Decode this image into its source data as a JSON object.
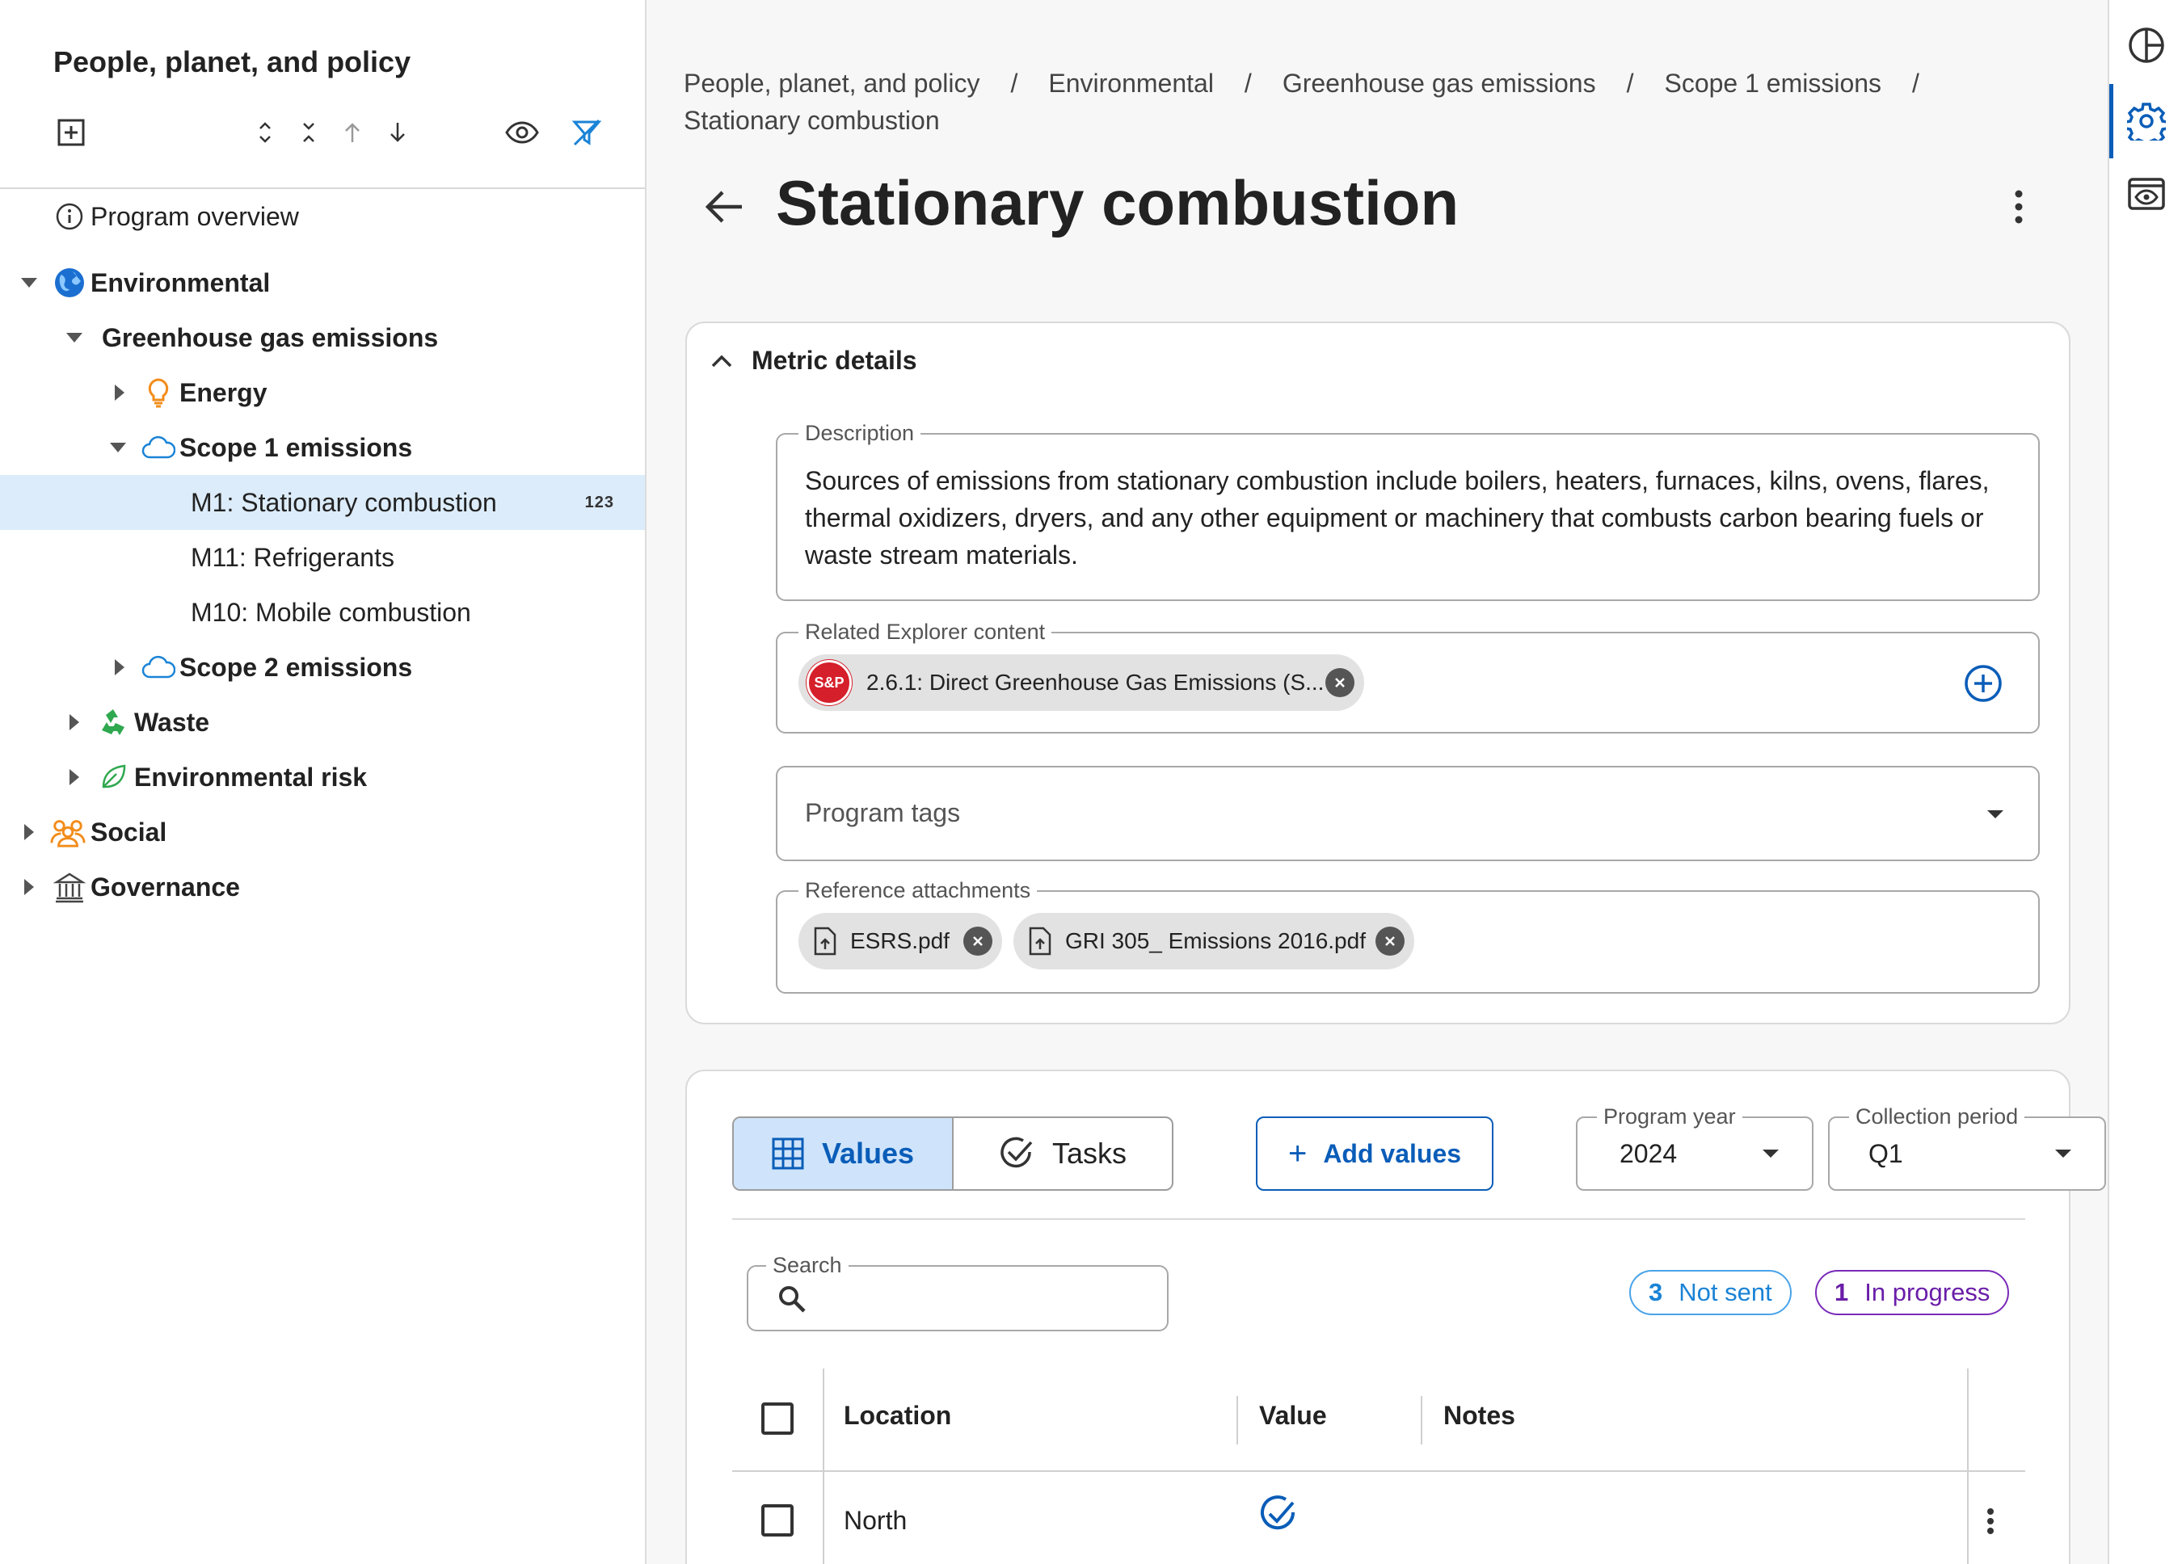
{
  "sidebar": {
    "title": "People, planet, and policy",
    "tree": [
      {
        "label": "Program overview",
        "icon": "info-icon",
        "bold": false
      },
      {
        "label": "Environmental",
        "icon": "globe-icon",
        "bold": true
      },
      {
        "label": "Greenhouse gas emissions",
        "icon": "",
        "bold": true
      },
      {
        "label": "Energy",
        "icon": "lightbulb-icon",
        "bold": true
      },
      {
        "label": "Scope 1 emissions",
        "icon": "cloud-icon",
        "bold": true
      },
      {
        "label": "M1: Stationary combustion",
        "icon": "",
        "bold": false,
        "badge": "123",
        "selected": true
      },
      {
        "label": "M11: Refrigerants",
        "icon": "",
        "bold": false
      },
      {
        "label": "M10: Mobile combustion",
        "icon": "",
        "bold": false
      },
      {
        "label": "Scope 2 emissions",
        "icon": "cloud-icon",
        "bold": true
      },
      {
        "label": "Waste",
        "icon": "recycle-icon",
        "bold": true
      },
      {
        "label": "Environmental risk",
        "icon": "leaf-icon",
        "bold": true
      },
      {
        "label": "Social",
        "icon": "people-icon",
        "bold": true
      },
      {
        "label": "Governance",
        "icon": "bank-icon",
        "bold": true
      }
    ]
  },
  "breadcrumb": {
    "items": [
      "People, planet, and policy",
      "Environmental",
      "Greenhouse gas emissions",
      "Scope 1 emissions"
    ],
    "current": "Stationary combustion",
    "separator": "/"
  },
  "page": {
    "title": "Stationary combustion"
  },
  "metric_details": {
    "heading": "Metric details",
    "description_label": "Description",
    "description": "Sources of emissions from stationary combustion include boilers, heaters, furnaces, kilns, ovens, flares, thermal oxidizers, dryers, and any other equipment or machinery that combusts carbon bearing fuels or waste stream materials.",
    "related_label": "Related Explorer content",
    "related_logo": "S&P",
    "related_chip": "2.6.1: Direct Greenhouse Gas Emissions (S...",
    "tags_placeholder": "Program tags",
    "attachments_label": "Reference attachments",
    "attachments": [
      "ESRS.pdf",
      "GRI 305_ Emissions 2016.pdf"
    ]
  },
  "values_panel": {
    "tab_values": "Values",
    "tab_tasks": "Tasks",
    "add_values": "Add values",
    "program_year_label": "Program year",
    "program_year": "2024",
    "collection_period_label": "Collection period",
    "collection_period": "Q1",
    "search_label": "Search",
    "status_not_sent_count": "3",
    "status_not_sent": "Not sent",
    "status_in_progress_count": "1",
    "status_in_progress": "In progress",
    "columns": [
      "Location",
      "Value",
      "Notes"
    ],
    "rows": [
      {
        "location": "North",
        "value_status": "check-circle-icon"
      }
    ]
  },
  "colors": {
    "accent": "#0a5db8",
    "selected_row": "#dcecfa",
    "not_sent": "#1a83d6",
    "in_progress": "#6a1ea8"
  }
}
